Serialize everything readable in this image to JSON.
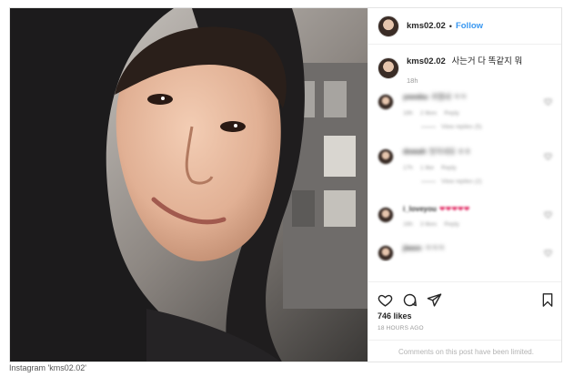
{
  "header": {
    "username": "kms02.02",
    "separator": "•",
    "follow_label": "Follow"
  },
  "caption": {
    "username": "kms02.02",
    "text": "사는거 다 똑같지 뭐",
    "time": "18h"
  },
  "comments": [
    {
      "username": "yeeebu",
      "text": "귀엽네 ㅋㅋ",
      "time": "18h",
      "likes": "2 likes",
      "reply": "Reply",
      "view_replies": "View replies (5)"
    },
    {
      "username": "dowah",
      "text": "멋지네요 ㅎㅎ",
      "time": "17h",
      "likes": "1 like",
      "reply": "Reply",
      "view_replies": "View replies (2)"
    },
    {
      "username": "i_loveyou",
      "text": "❤❤❤❤❤",
      "time": "16h",
      "likes": "3 likes",
      "reply": "Reply"
    },
    {
      "username": "jiwon",
      "text": "ㅋㅋㅋ",
      "time": "",
      "likes": "",
      "reply": ""
    }
  ],
  "actions": {
    "like_icon": "heart-icon",
    "comment_icon": "comment-icon",
    "share_icon": "share-icon",
    "save_icon": "bookmark-icon"
  },
  "likes": "746 likes",
  "posted": "18 HOURS AGO",
  "comments_limited": "Comments on this post have been limited.",
  "credit": "Instagram 'kms02.02'",
  "colors": {
    "follow": "#3897f0",
    "border": "#efefef",
    "heart": "#e0245e"
  }
}
